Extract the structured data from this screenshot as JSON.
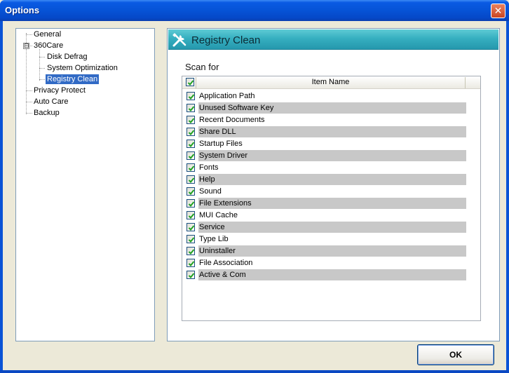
{
  "window": {
    "title": "Options",
    "close_label": "✕"
  },
  "tree": {
    "items": [
      {
        "label": "General"
      },
      {
        "label": "360Care",
        "expander": "⊟"
      },
      {
        "label": "Disk Defrag"
      },
      {
        "label": "System Optimization"
      },
      {
        "label": "Registry Clean",
        "selected": true
      },
      {
        "label": "Privacy Protect"
      },
      {
        "label": "Auto Care"
      },
      {
        "label": "Backup"
      }
    ]
  },
  "panel": {
    "title": "Registry Clean",
    "icon": "tools-icon",
    "scan_for_label": "Scan for",
    "list": {
      "header": {
        "column": "Item Name",
        "all_checked": true
      },
      "rows": [
        {
          "label": "Application Path",
          "checked": true
        },
        {
          "label": "Unused Software Key",
          "checked": true
        },
        {
          "label": "Recent Documents",
          "checked": true
        },
        {
          "label": "Share DLL",
          "checked": true
        },
        {
          "label": "Startup Files",
          "checked": true
        },
        {
          "label": "System Driver",
          "checked": true
        },
        {
          "label": "Fonts",
          "checked": true
        },
        {
          "label": "Help",
          "checked": true
        },
        {
          "label": "Sound",
          "checked": true
        },
        {
          "label": "File Extensions",
          "checked": true
        },
        {
          "label": "MUI Cache",
          "checked": true
        },
        {
          "label": "Service",
          "checked": true
        },
        {
          "label": "Type Lib",
          "checked": true
        },
        {
          "label": "Uninstaller",
          "checked": true
        },
        {
          "label": "File Association",
          "checked": true
        },
        {
          "label": "Active & Com",
          "checked": true
        }
      ]
    }
  },
  "footer": {
    "ok_label": "OK"
  },
  "colors": {
    "titlebar": "#0653d6",
    "selection": "#316ac5",
    "header_teal": "#36afc0",
    "row_shade": "#c8c8c8",
    "check_green": "#21a121"
  }
}
